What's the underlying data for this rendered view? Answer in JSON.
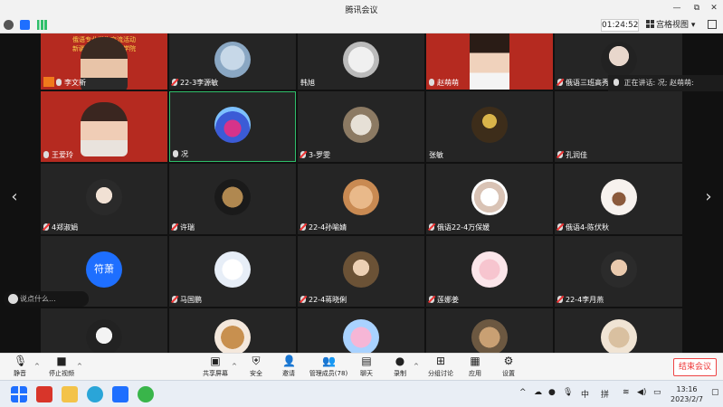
{
  "window": {
    "title": "腾讯会议",
    "minimize": "—",
    "maximize": "⧉",
    "close": "✕"
  },
  "status": {
    "timer": "01:24:52",
    "view_label": "宫格视图",
    "caret": "▾"
  },
  "speaking": {
    "label": "正在讲话:",
    "names": "况; 赵萌萌:"
  },
  "chat": {
    "placeholder": "说点什么..."
  },
  "banner": {
    "line1": "俄语专业学生交流活动",
    "line2": "新疆师范大学俄语学院",
    "line3": "交换学生"
  },
  "participants": [
    {
      "name": "李文新",
      "mic": "on",
      "host": true
    },
    {
      "name": "22-3李源敏",
      "mic": "off"
    },
    {
      "name": "韩旭",
      "mic": "none"
    },
    {
      "name": "赵萌萌",
      "mic": "on"
    },
    {
      "name": "俄语三班高秀",
      "mic": "off"
    },
    {
      "name": "王爱玲",
      "mic": "on"
    },
    {
      "name": "况",
      "mic": "on"
    },
    {
      "name": "3-罗雯",
      "mic": "off"
    },
    {
      "name": "张敏",
      "mic": "none"
    },
    {
      "name": "孔润佳",
      "mic": "off"
    },
    {
      "name": "4郑淑娟",
      "mic": "off"
    },
    {
      "name": "许瑞",
      "mic": "off"
    },
    {
      "name": "22-4孙喻婧",
      "mic": "off"
    },
    {
      "name": "俄语22-4万保媛",
      "mic": "off"
    },
    {
      "name": "俄语4-陈伏秋",
      "mic": "off"
    },
    {
      "name": "符萧",
      "mic": "off",
      "avatar_text": "符萧"
    },
    {
      "name": "马国鹏",
      "mic": "off"
    },
    {
      "name": "22-4蒋晓俐",
      "mic": "off"
    },
    {
      "name": "莲娜姜",
      "mic": "off"
    },
    {
      "name": "22-4李月燕",
      "mic": "off"
    }
  ],
  "toolbar": {
    "mute": "静音",
    "stop_video": "停止视频",
    "share": "共享屏幕",
    "security": "安全",
    "invite": "邀请",
    "members": "管理成员(78)",
    "chat": "聊天",
    "record": "录制",
    "breakout": "分组讨论",
    "apps": "应用",
    "settings": "设置",
    "end": "结束会议"
  },
  "taskbar": {
    "ime_lang": "中",
    "ime_mode": "拼",
    "time": "13:16",
    "date": "2023/2/7"
  },
  "colors": {
    "accent": "#2fbf6a",
    "end": "#e33333",
    "host": "#f07a1c",
    "avatar_blue": "#1e6fff"
  }
}
